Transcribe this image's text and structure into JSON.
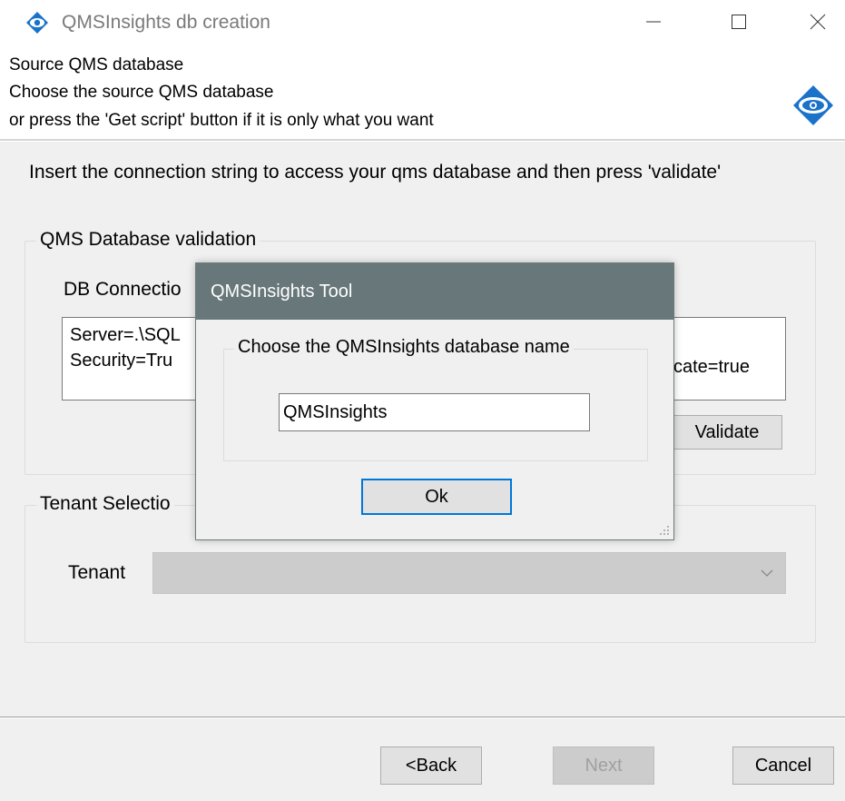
{
  "window": {
    "title": "QMSInsights db creation",
    "icon": "eye-logo-icon",
    "controls": {
      "minimize": "minimize-icon",
      "maximize": "maximize-icon",
      "close": "close-icon"
    }
  },
  "header": {
    "line1": "Source QMS database",
    "line2": "Choose the source QMS database",
    "line3": "or press the 'Get script' button if it is only what you want",
    "logo": "eye-logo-icon"
  },
  "instruction": "Insert the connection string to access your qms database and then press 'validate'",
  "validation_group": {
    "legend": "QMS Database validation",
    "conn_label": "DB Connectio",
    "conn_line1": "Server=.\\SQL",
    "conn_line2": "Security=Tru",
    "conn_tail": "cate=true",
    "validate_label": "Validate"
  },
  "tenant_group": {
    "legend": "Tenant Selectio",
    "tenant_label": "Tenant",
    "tenant_value": ""
  },
  "footer": {
    "back_label": "<Back",
    "next_label": "Next",
    "cancel_label": "Cancel"
  },
  "dialog": {
    "title": "QMSInsights Tool",
    "group_legend": "Choose the QMSInsights database name",
    "db_name_value": "QMSInsights",
    "ok_label": "Ok"
  },
  "colors": {
    "dialog_titlebar": "#68777a",
    "focus_border": "#0078d7",
    "logo_blue": "#1a73c9"
  }
}
